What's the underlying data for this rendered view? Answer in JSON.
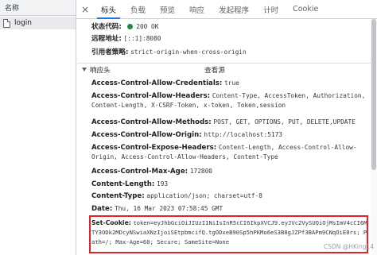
{
  "left_panel": {
    "header": "名称",
    "requests": [
      {
        "name": "login"
      }
    ]
  },
  "tabs": [
    "标头",
    "负载",
    "预览",
    "响应",
    "发起程序",
    "计时",
    "Cookie"
  ],
  "general": {
    "status_code_label": "状态代码:",
    "status_code_value": "200 OK",
    "remote_address_label": "远程地址:",
    "remote_address_value": "[::1]:8080",
    "referrer_policy_label": "引用者策略:",
    "referrer_policy_value": "strict-origin-when-cross-origin"
  },
  "response_headers": {
    "title": "响应头",
    "view_source": "查看源",
    "acac_name": "Access-Control-Allow-Credentials:",
    "acac_value": "true",
    "acah_name": "Access-Control-Allow-Headers:",
    "acah_value": "Content-Type, AccessToken, Authorization, Content-Length, X-CSRF-Token, x-token, Token,session",
    "acam_name": "Access-Control-Allow-Methods:",
    "acam_value": "POST, GET, OPTIONS, PUT, DELETE,UPDATE",
    "acao_name": "Access-Control-Allow-Origin:",
    "acao_value": "http://localhost:5173",
    "aceh_name": "Access-Control-Expose-Headers:",
    "aceh_value": "Content-Length, Access-Control-Allow-Origin, Access-Control-Allow-Headers, Content-Type",
    "acma_name": "Access-Control-Max-Age:",
    "acma_value": "172800",
    "cl_name": "Content-Length:",
    "cl_value": "193",
    "ct_name": "Content-Type:",
    "ct_value": "application/json; charset=utf-8",
    "date_name": "Date:",
    "date_value": "Thu, 16 Mar 2023 07:58:45 GMT",
    "sc_name": "Set-Cookie:",
    "sc_value": "token=eyJhbGciOiJIUzI1NiIsInR5cCI6IkpXVCJ9.eyJVc2VySUQiOjMsImV4cCI6MTY3ODk2MDcyNSwiaXNzIjoiSEtpbmcifQ.tgODxeB90Sp5hPKMo6eS3B8gJZPf3BAPm9CNqOiE0rs; Path=/; Max-Age=60; Secure; SameSite=None"
  },
  "watermark": "CSDN @HKing14",
  "colors": {
    "accent": "#1a73e8",
    "highlight": "#e8202a",
    "status_ok": "#1e8e3e"
  }
}
